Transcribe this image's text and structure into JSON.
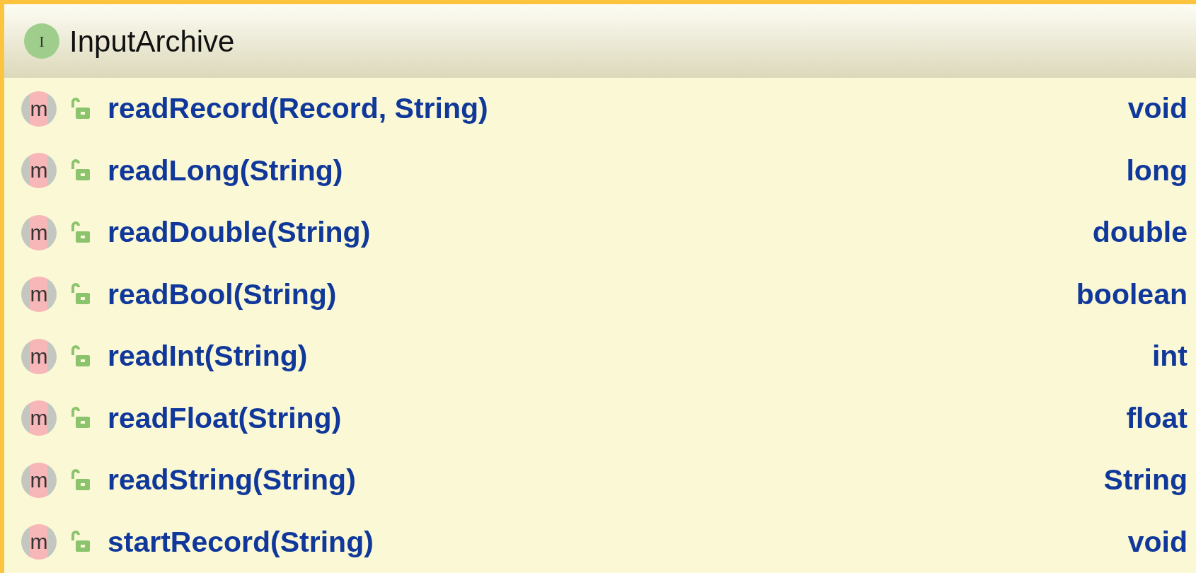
{
  "header": {
    "title": "InputArchive",
    "badge": "I"
  },
  "methods": [
    {
      "signature": "readRecord(Record, String)",
      "type": "void",
      "badge": "m"
    },
    {
      "signature": "readLong(String)",
      "type": "long",
      "badge": "m"
    },
    {
      "signature": "readDouble(String)",
      "type": "double",
      "badge": "m"
    },
    {
      "signature": "readBool(String)",
      "type": "boolean",
      "badge": "m"
    },
    {
      "signature": "readInt(String)",
      "type": "int",
      "badge": "m"
    },
    {
      "signature": "readFloat(String)",
      "type": "float",
      "badge": "m"
    },
    {
      "signature": "readString(String)",
      "type": "String",
      "badge": "m"
    },
    {
      "signature": "startRecord(String)",
      "type": "void",
      "badge": "m"
    }
  ]
}
